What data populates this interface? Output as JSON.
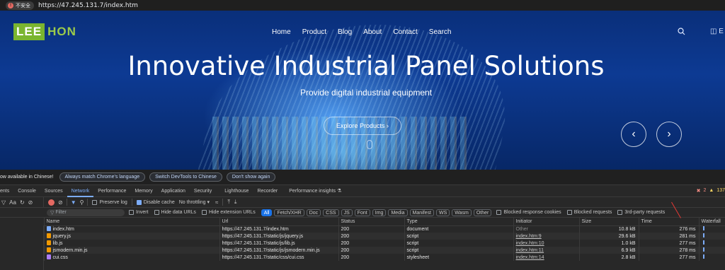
{
  "address_bar": {
    "security_label": "不安全",
    "url": "https://47.245.131.7/index.htm"
  },
  "site": {
    "logo": {
      "part1": "LEE",
      "part2": "HON"
    },
    "nav": [
      "Home",
      "Product",
      "Blog",
      "About",
      "Contact",
      "Search"
    ],
    "hero_title": "Innovative Industrial Panel Solutions",
    "hero_subtitle": "Provide digital industrial equipment",
    "cta": "Explore Products",
    "prev_glyph": "‹",
    "next_glyph": "›",
    "right_cut_text": "E"
  },
  "devtools": {
    "infobar": {
      "message": "ow available in Chinese!",
      "buttons": [
        "Always match Chrome's language",
        "Switch DevTools to Chinese",
        "Don't show again"
      ]
    },
    "tabs": [
      "ents",
      "Console",
      "Sources",
      "Network",
      "Performance",
      "Memory",
      "Application",
      "Security",
      "Lighthouse",
      "Recorder",
      "Performance insights ⚗"
    ],
    "active_tab": "Network",
    "error_count": "2",
    "warning_count": "137",
    "toolbar": {
      "preserve_log": "Preserve log",
      "disable_cache": "Disable cache",
      "throttling": "No throttling"
    },
    "filter": {
      "placeholder": "Filter",
      "invert": "Invert",
      "hide_data_urls": "Hide data URLs",
      "hide_extension_urls": "Hide extension URLs",
      "types": [
        "All",
        "Fetch/XHR",
        "Doc",
        "CSS",
        "JS",
        "Font",
        "Img",
        "Media",
        "Manifest",
        "WS",
        "Wasm",
        "Other"
      ],
      "blocked_cookies": "Blocked response cookies",
      "blocked_requests": "Blocked requests",
      "third_party": "3rd-party requests"
    },
    "columns": [
      "Name",
      "Url",
      "Status",
      "Type",
      "Initiator",
      "Size",
      "Time",
      "Waterfall"
    ],
    "rows": [
      {
        "name": "index.htm",
        "url": "https://47.245.131.7/index.htm",
        "status": "200",
        "type": "document",
        "initiator": "Other",
        "size": "10.8 kB",
        "time": "276 ms",
        "icon": "doc"
      },
      {
        "name": "jquery.js",
        "url": "https://47.245.131.7/static/js/jquery.js",
        "status": "200",
        "type": "script",
        "initiator": "index.htm:9",
        "size": "29.6 kB",
        "time": "281 ms",
        "icon": "js"
      },
      {
        "name": "lib.js",
        "url": "https://47.245.131.7/static/js/lib.js",
        "status": "200",
        "type": "script",
        "initiator": "index.htm:10",
        "size": "1.0 kB",
        "time": "277 ms",
        "icon": "js"
      },
      {
        "name": "jsmodern.min.js",
        "url": "https://47.245.131.7/static/js/jsmodern.min.js",
        "status": "200",
        "type": "script",
        "initiator": "index.htm:11",
        "size": "6.9 kB",
        "time": "278 ms",
        "icon": "js"
      },
      {
        "name": "cui.css",
        "url": "https://47.245.131.7/static/css/cui.css",
        "status": "200",
        "type": "stylesheet",
        "initiator": "index.htm:14",
        "size": "2.8 kB",
        "time": "277 ms",
        "icon": "css"
      }
    ]
  }
}
